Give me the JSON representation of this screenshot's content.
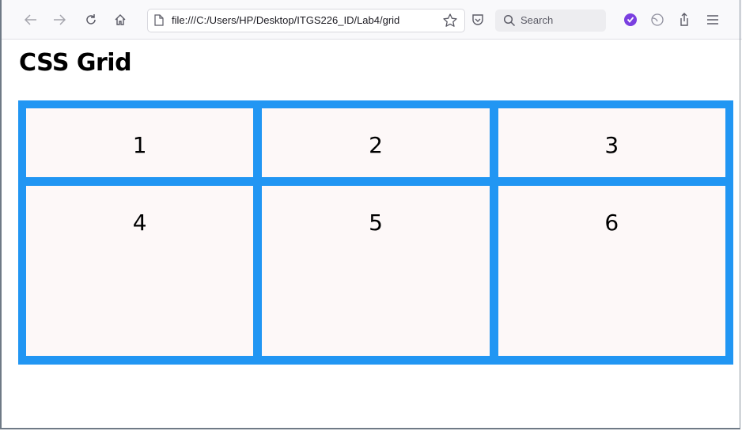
{
  "browser": {
    "url": "file:///C:/Users/HP/Desktop/ITGS226_ID/Lab4/grid",
    "search_placeholder": "Search",
    "icons": [
      "back-arrow-icon",
      "forward-arrow-icon",
      "reload-icon",
      "home-icon",
      "page-icon",
      "bookmark-star-icon",
      "pocket-icon",
      "search-icon",
      "extension-icon",
      "profile-icon",
      "share-icon",
      "menu-icon"
    ],
    "accent_extension_color": "#7a3fe0"
  },
  "page": {
    "heading": "CSS Grid",
    "grid_border_color": "#2196f3",
    "cell_background": "#fdf8f8",
    "items": [
      "1",
      "2",
      "3",
      "4",
      "5",
      "6"
    ]
  }
}
